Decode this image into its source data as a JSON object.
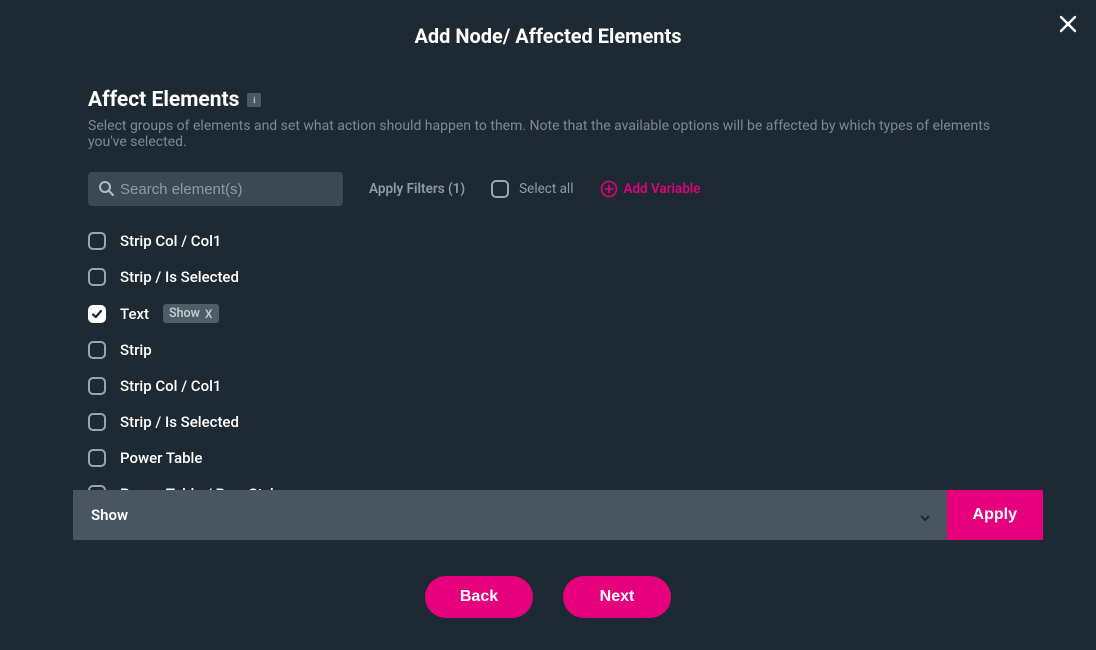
{
  "header": {
    "title": "Add Node/ Affected Elements"
  },
  "section": {
    "title": "Affect Elements",
    "description": "Select groups of elements and set what action should happen to them. Note that the available options will be affected by which types of elements you've selected."
  },
  "filters": {
    "search_placeholder": "Search element(s)",
    "apply_filters_label": "Apply Filters (1)",
    "select_all_label": "Select all",
    "add_variable_label": "Add Variable"
  },
  "elements": [
    {
      "label": "Strip Col / Col1",
      "checked": false,
      "action": null
    },
    {
      "label": "Strip / Is Selected",
      "checked": false,
      "action": null
    },
    {
      "label": "Text",
      "checked": true,
      "action": "Show"
    },
    {
      "label": "Strip",
      "checked": false,
      "action": null
    },
    {
      "label": "Strip Col / Col1",
      "checked": false,
      "action": null
    },
    {
      "label": "Strip / Is Selected",
      "checked": false,
      "action": null
    },
    {
      "label": "Power Table",
      "checked": false,
      "action": null
    },
    {
      "label": "Power Table / Row Style",
      "checked": false,
      "action": null
    }
  ],
  "action_bar": {
    "selected_action": "Show",
    "apply_label": "Apply"
  },
  "footer": {
    "back_label": "Back",
    "next_label": "Next"
  }
}
